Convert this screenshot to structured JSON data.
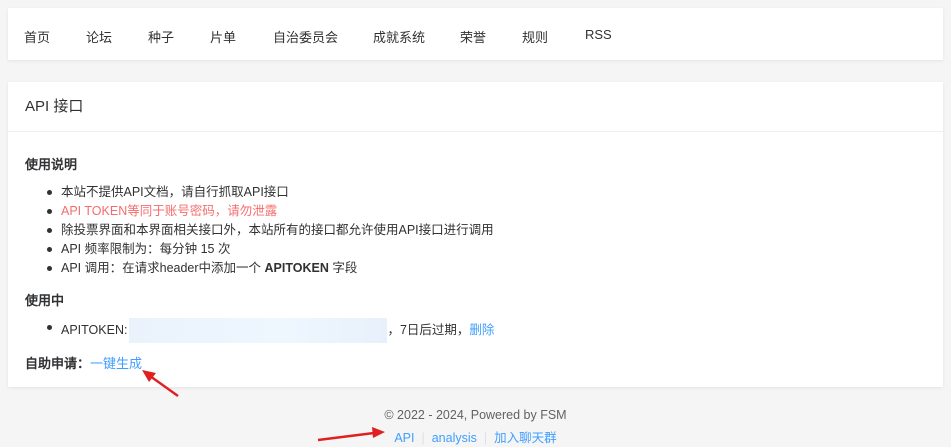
{
  "nav": {
    "items": [
      "首页",
      "论坛",
      "种子",
      "片单",
      "自治委员会",
      "成就系统",
      "荣誉",
      "规则",
      "RSS"
    ]
  },
  "card": {
    "title": "API 接口",
    "usage": {
      "title": "使用说明",
      "items": [
        "本站不提供API文档，请自行抓取API接口",
        "API TOKEN等同于账号密码，请勿泄露",
        "除投票界面和本界面相关接口外，本站所有的接口都允许使用API接口进行调用",
        "API 频率限制为：每分钟 15 次"
      ],
      "header_item_prefix": "API 调用：在请求header中添加一个 ",
      "header_item_key": "APITOKEN",
      "header_item_suffix": " 字段"
    },
    "in_use": {
      "title": "使用中",
      "token_label": "APITOKEN:",
      "expire_text": "，7日后过期，",
      "delete_label": "删除"
    },
    "self_apply": {
      "label": "自助申请：",
      "generate_label": "一键生成"
    }
  },
  "footer": {
    "copyright": "© 2022 - 2024, Powered by FSM",
    "links": [
      "API",
      "analysis",
      "加入聊天群"
    ]
  },
  "colors": {
    "link": "#409eff",
    "warning": "#f56c6c",
    "arrow": "#e02020"
  }
}
